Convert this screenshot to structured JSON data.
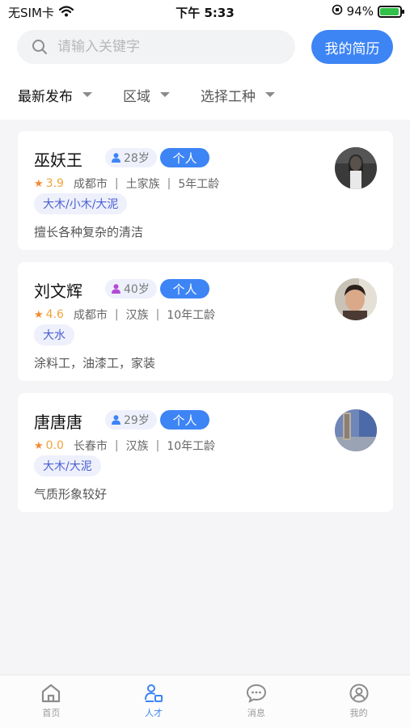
{
  "status_bar": {
    "carrier": "无SIM卡",
    "time": "下午 5:33",
    "battery": "94%",
    "battery_level": 0.94
  },
  "search": {
    "placeholder": "请输入关键字",
    "value": ""
  },
  "resume_button": "我的简历",
  "filters": [
    {
      "label": "最新发布"
    },
    {
      "label": "区域"
    },
    {
      "label": "选择工种"
    }
  ],
  "workers": [
    {
      "name": "巫妖王",
      "age": "28岁",
      "type": "个人",
      "rating": "3.9",
      "city": "成都市",
      "ethnicity": "土家族",
      "experience": "5年工龄",
      "tags": [
        "大木/小木/大泥"
      ],
      "description": "擅长各种复杂的清洁",
      "icon_color": "#3d84f5"
    },
    {
      "name": "刘文辉",
      "age": "40岁",
      "type": "个人",
      "rating": "4.6",
      "city": "成都市",
      "ethnicity": "汉族",
      "experience": "10年工龄",
      "tags": [
        "大水"
      ],
      "description": "涂料工，油漆工，家装",
      "icon_color": "#b34ad6"
    },
    {
      "name": "唐唐唐",
      "age": "29岁",
      "type": "个人",
      "rating": "0.0",
      "city": "长春市",
      "ethnicity": "汉族",
      "experience": "10年工龄",
      "tags": [
        "大木/大泥"
      ],
      "description": "气质形象较好",
      "icon_color": "#3d84f5"
    }
  ],
  "tab_bar": [
    {
      "label": "首页",
      "icon": "home-icon"
    },
    {
      "label": "人才",
      "icon": "talent-icon",
      "active": true
    },
    {
      "label": "消息",
      "icon": "message-icon"
    },
    {
      "label": "我的",
      "icon": "profile-icon"
    }
  ],
  "colors": {
    "accent": "#3d84f5",
    "star": "#f5892d",
    "tag_text": "#4a5fd1",
    "tag_bg": "#eef0fc"
  }
}
